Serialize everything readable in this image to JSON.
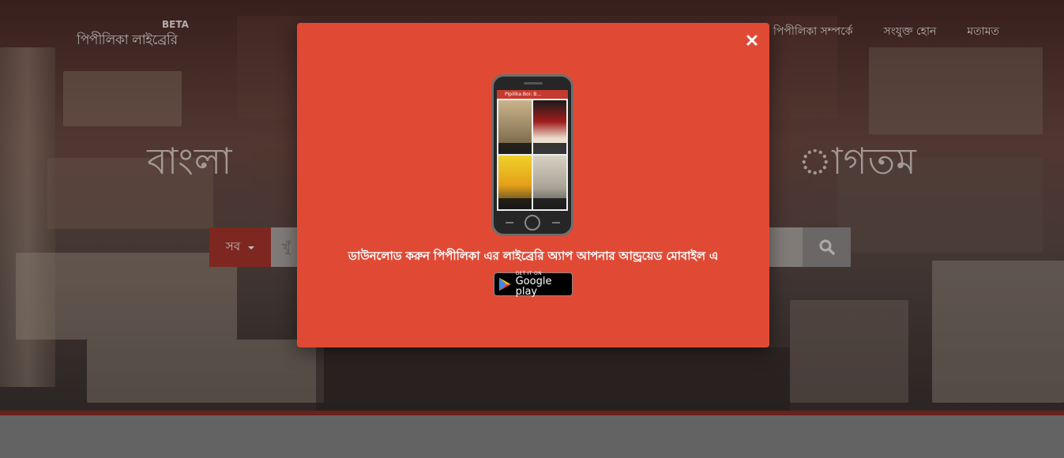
{
  "header": {
    "logo_text": "পিপীলিকা লাইব্রেরি",
    "logo_beta": "BETA",
    "nav": [
      "পিপীলিকা সম্পর্কে",
      "সংযুক্ত হোন",
      "মতামত"
    ]
  },
  "hero": {
    "headline": "বাংলা                                              াগতম"
  },
  "search": {
    "category_label": "সব",
    "placeholder": "খুঁ"
  },
  "modal": {
    "app_bar_title": "Pipilika Boi: B...",
    "message": "ডাউনলোড করুন পিপীলিকা এর লাইব্রেরি অ্যাপ আপনার আন্ড্রয়েড মোবাইল এ",
    "store_small": "GET IT ON",
    "store_big": "Google play"
  },
  "colors": {
    "modal_bg": "#e04a35",
    "accent_red": "#a9352b",
    "hero_bottom_bar": "#8e2d24"
  },
  "icons": [
    "close-icon",
    "search-icon",
    "google-play-icon",
    "chevron-down-icon"
  ]
}
